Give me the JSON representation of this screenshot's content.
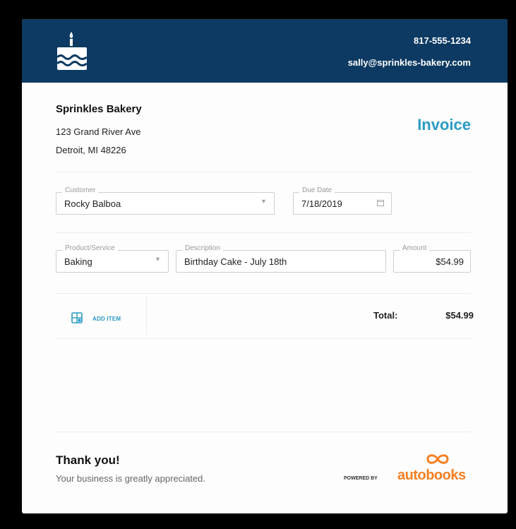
{
  "header": {
    "phone": "817-555-1234",
    "email": "sally@sprinkles-bakery.com"
  },
  "company": {
    "name": "Sprinkles Bakery",
    "address_line1": "123 Grand River Ave",
    "address_line2": "Detroit, MI 48226"
  },
  "invoice_title": "Invoice",
  "customer": {
    "label": "Customer",
    "value": "Rocky Balboa"
  },
  "due_date": {
    "label": "Due Date",
    "value": "7/18/2019"
  },
  "line_item": {
    "product": {
      "label": "Product/Service",
      "value": "Baking"
    },
    "description": {
      "label": "Description",
      "value": "Birthday Cake - July 18th"
    },
    "amount": {
      "label": "Amount",
      "value": "$54.99"
    }
  },
  "add_item_label": "ADD ITEM",
  "total": {
    "label": "Total:",
    "value": "$54.99"
  },
  "footer": {
    "thanks": "Thank you!",
    "message": "Your business is greatly appreciated.",
    "powered_by": "POWERED BY",
    "brand": "autobooks"
  },
  "colors": {
    "header_bg": "#0d3a62",
    "accent": "#2a9bc3",
    "brand_orange": "#f57f21"
  },
  "icons": [
    "cake-icon",
    "chevron-down-icon",
    "calendar-icon",
    "add-item-icon",
    "autobooks-logo-icon"
  ]
}
